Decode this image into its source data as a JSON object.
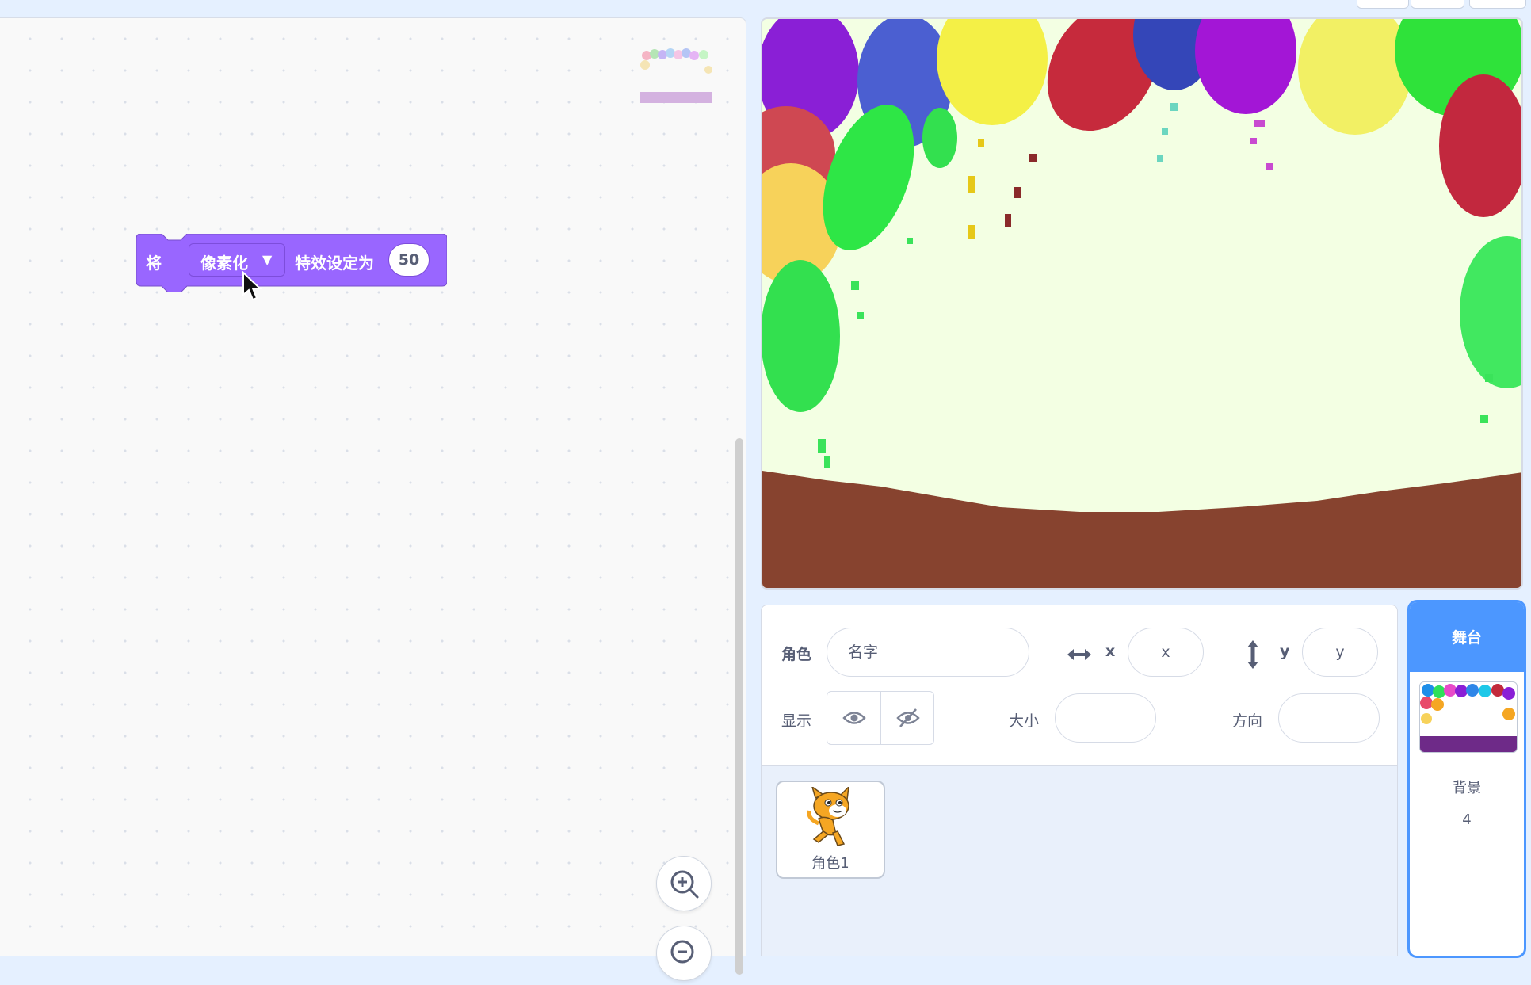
{
  "code_area": {
    "block": {
      "prefix": "将",
      "effect_option": "像素化",
      "middle": "特效设定为",
      "value": "50",
      "color": "#9966ff"
    },
    "zoom_in_icon": "zoom-in-icon",
    "zoom_out_icon": "zoom-out-icon"
  },
  "stage": {
    "backdrop": "party-balloons"
  },
  "sprite_info": {
    "sprite_label": "角色",
    "name_placeholder": "名字",
    "x_label": "x",
    "x_placeholder": "x",
    "y_label": "y",
    "y_placeholder": "y",
    "show_label": "显示",
    "size_label": "大小",
    "direction_label": "方向"
  },
  "sprites": [
    {
      "name": "角色1"
    }
  ],
  "stage_selector": {
    "header": "舞台",
    "backdrops_label": "背景",
    "backdrop_count": "4",
    "accent": "#4c97ff"
  }
}
